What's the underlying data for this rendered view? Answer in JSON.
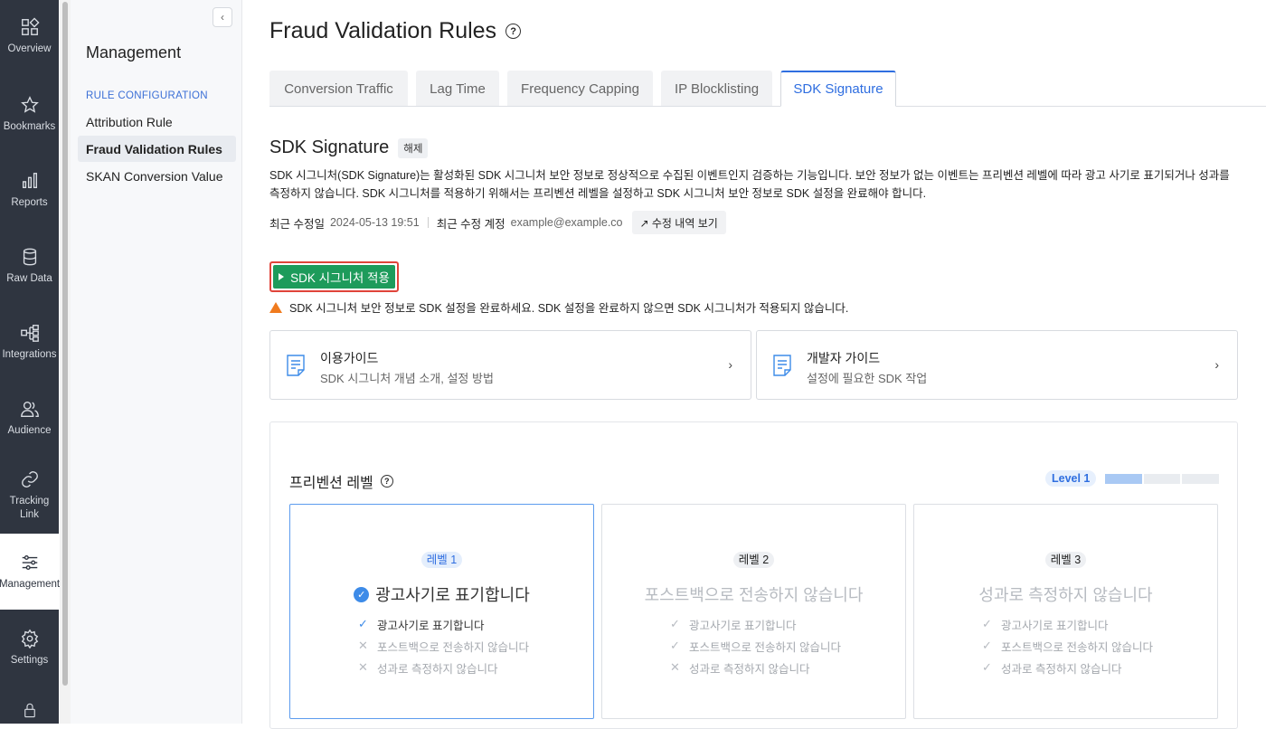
{
  "rail": {
    "items": [
      {
        "label": "Overview",
        "icon": "overview-icon"
      },
      {
        "label": "Bookmarks",
        "icon": "star-icon"
      },
      {
        "label": "Reports",
        "icon": "bar-chart-icon"
      },
      {
        "label": "Raw Data",
        "icon": "database-icon"
      },
      {
        "label": "Integrations",
        "icon": "integrations-icon"
      },
      {
        "label": "Audience",
        "icon": "audience-icon"
      },
      {
        "label": "Tracking Link",
        "icon": "link-icon"
      },
      {
        "label": "Management",
        "icon": "sliders-icon"
      },
      {
        "label": "Settings",
        "icon": "gear-icon"
      }
    ]
  },
  "sidebar": {
    "collapse": "‹",
    "title": "Management",
    "section": "RULE CONFIGURATION",
    "items": [
      "Attribution Rule",
      "Fraud Validation Rules",
      "SKAN Conversion Value"
    ]
  },
  "page": {
    "title": "Fraud Validation Rules",
    "help": "?",
    "tabs": [
      "Conversion Traffic",
      "Lag Time",
      "Frequency Capping",
      "IP Blocklisting",
      "SDK Signature"
    ],
    "active_tab": "SDK Signature"
  },
  "section": {
    "title": "SDK Signature",
    "status": "해제",
    "description": "SDK 시그니처(SDK Signature)는 활성화된 SDK 시그니처 보안 정보로 정상적으로 수집된 이벤트인지 검증하는 기능입니다. 보안 정보가 없는 이벤트는 프리벤션 레벨에 따라 광고 사기로 표기되거나 성과를 측정하지 않습니다. SDK 시그니처를 적용하기 위해서는 프리벤션 레벨을 설정하고 SDK 시그니처 보안 정보로 SDK 설정을 완료해야 합니다.",
    "modified_label": "최근 수정일",
    "modified_value": "2024-05-13 19:51",
    "account_label": "최근 수정 계정",
    "account_value": "example@example.co",
    "history_button": "↗ 수정 내역 보기",
    "apply_button": "SDK 시그니처 적용",
    "warning": "SDK 시그니처 보안 정보로 SDK 설정을 완료하세요. SDK 설정을 완료하지 않으면 SDK 시그니처가 적용되지 않습니다."
  },
  "guides": [
    {
      "title": "이용가이드",
      "subtitle": "SDK 시그니처 개념 소개, 설정 방법"
    },
    {
      "title": "개발자 가이드",
      "subtitle": "설정에 필요한 SDK 작업"
    }
  ],
  "prevention": {
    "title": "프리벤션 레벨",
    "level_badge": "Level 1",
    "level_value": 1,
    "level_max": 3,
    "cards": [
      {
        "badge": "레벨 1",
        "headline": "광고사기로 표기합니다",
        "items": [
          {
            "mark": "✓",
            "text": "광고사기로 표기합니다",
            "on": true
          },
          {
            "mark": "✕",
            "text": "포스트백으로 전송하지 않습니다",
            "on": false
          },
          {
            "mark": "✕",
            "text": "성과로 측정하지 않습니다",
            "on": false
          }
        ]
      },
      {
        "badge": "레벨 2",
        "headline": "포스트백으로 전송하지 않습니다",
        "items": [
          {
            "mark": "✓",
            "text": "광고사기로 표기합니다",
            "on": false
          },
          {
            "mark": "✓",
            "text": "포스트백으로 전송하지 않습니다",
            "on": false
          },
          {
            "mark": "✕",
            "text": "성과로 측정하지 않습니다",
            "on": false
          }
        ]
      },
      {
        "badge": "레벨 3",
        "headline": "성과로 측정하지 않습니다",
        "items": [
          {
            "mark": "✓",
            "text": "광고사기로 표기합니다",
            "on": false
          },
          {
            "mark": "✓",
            "text": "포스트백으로 전송하지 않습니다",
            "on": false
          },
          {
            "mark": "✓",
            "text": "성과로 측정하지 않습니다",
            "on": false
          }
        ]
      }
    ]
  }
}
